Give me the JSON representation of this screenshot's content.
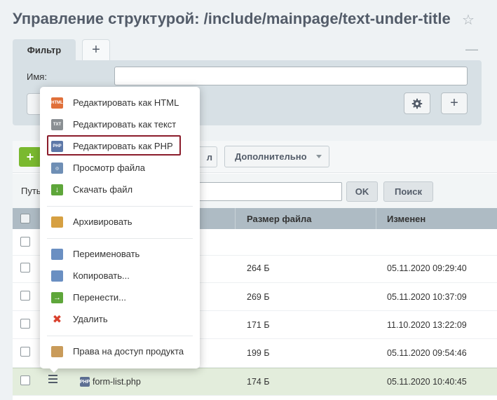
{
  "title": "Управление структурой: /include/mainpage/text-under-title",
  "filter": {
    "tab_label": "Фильтр",
    "add_tab": "+",
    "collapse": "—",
    "name_label": "Имя:",
    "name_value": "",
    "settings_icon": "gear-icon",
    "add_button": "+"
  },
  "toolbar": {
    "add_button": "+",
    "hidden_button_tail": "л",
    "extra_label": "Дополнительно"
  },
  "path": {
    "label": "Путь",
    "value": "",
    "ok": "OK",
    "search": "Поиск"
  },
  "grid": {
    "columns": [
      "Размер файла",
      "Изменен"
    ],
    "rows": [
      {
        "size": "",
        "modified": ""
      },
      {
        "size": "264 Б",
        "modified": "05.11.2020 09:29:40"
      },
      {
        "size": "269 Б",
        "modified": "05.11.2020 10:37:09"
      },
      {
        "size": "171 Б",
        "modified": "11.10.2020 13:22:09"
      },
      {
        "size": "199 Б",
        "modified": "05.11.2020 09:54:46"
      },
      {
        "name": "form-list.php",
        "size": "174 Б",
        "modified": "05.11.2020 10:40:45"
      }
    ]
  },
  "menu": {
    "items": [
      {
        "label": "Редактировать как HTML",
        "icon": "html-file-icon",
        "color": "#e0703a",
        "tag": "HTML"
      },
      {
        "label": "Редактировать как текст",
        "icon": "text-file-icon",
        "color": "#8a8f93",
        "tag": "TXT"
      },
      {
        "label": "Редактировать как PHP",
        "icon": "php-file-icon",
        "color": "#5d78a8",
        "tag": "PHP"
      },
      {
        "label": "Просмотр файла",
        "icon": "view-file-icon",
        "color": "#6f8fb5",
        "tag": ""
      },
      {
        "label": "Скачать файл",
        "icon": "download-icon",
        "color": "#5ea63a",
        "tag": ""
      },
      {
        "label": "Архивировать",
        "icon": "archive-icon",
        "color": "#d6a042",
        "tag": ""
      },
      {
        "label": "Переименовать",
        "icon": "rename-icon",
        "color": "#6a8fc2",
        "tag": ""
      },
      {
        "label": "Копировать...",
        "icon": "copy-icon",
        "color": "#6a8fc2",
        "tag": ""
      },
      {
        "label": "Перенести...",
        "icon": "move-icon",
        "color": "#5ea63a",
        "tag": ""
      },
      {
        "label": "Удалить",
        "icon": "delete-icon",
        "color": "#d9412e",
        "tag": ""
      },
      {
        "label": "Права на доступ продукта",
        "icon": "access-rights-icon",
        "color": "#c99b5a",
        "tag": ""
      }
    ]
  }
}
